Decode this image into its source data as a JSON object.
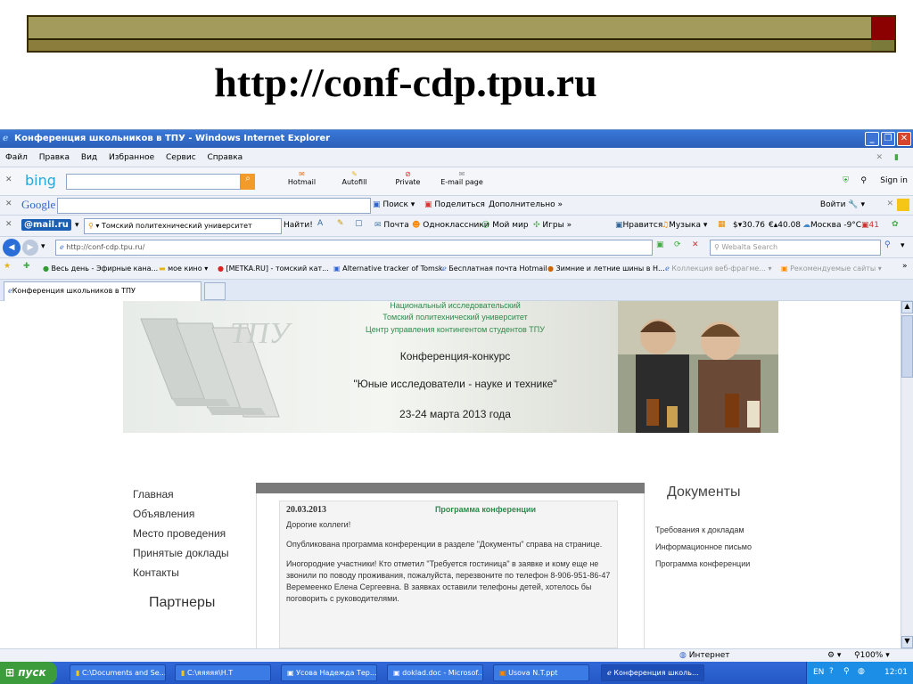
{
  "slide": {
    "title": "http://conf-cdp.tpu.ru"
  },
  "window": {
    "title": "Конференция школьников в ТПУ - Windows Internet Explorer"
  },
  "menu": [
    "Файл",
    "Правка",
    "Вид",
    "Избранное",
    "Сервис",
    "Справка"
  ],
  "bing": {
    "logo": "bing",
    "hotmail": "Hotmail",
    "autofill": "Autofill",
    "private": "Private",
    "email_page": "E-mail page",
    "sign_in": "Sign in"
  },
  "google": {
    "logo": "Google",
    "search": "Поиск",
    "share": "Поделиться",
    "more": "Дополнительно",
    "login": "Войти"
  },
  "mailru": {
    "logo": "@mail.ru",
    "query": "Томский политехнический университет",
    "find": "Найти!",
    "mail": "Почта",
    "ok": "Одноклассники",
    "moimir": "Мой мир",
    "games": "Игры",
    "like": "Нравится",
    "music": "Музыка",
    "usd": "30.76",
    "eur": "40.08",
    "weather": "Москва -9°C",
    "count": "41"
  },
  "address": {
    "url": "http://conf-cdp.tpu.ru/",
    "search_placeholder": "Webalta Search"
  },
  "favorites": [
    "Весь день - Эфирные кана...",
    "мое кино",
    "[METKA.RU] - томский кат...",
    "Alternative tracker of Tomsk",
    "Бесплатная почта Hotmail",
    "Зимние и летние шины в Н...",
    "Коллекция веб-фрагме...",
    "Рекомендуемые сайты"
  ],
  "tab": {
    "label": "Конференция школьников в ТПУ"
  },
  "banner": {
    "line1": "Национальный исследовательский",
    "line2": "Томский политехнический университет",
    "line3": "Центр управления контингентом студентов ТПУ",
    "conf": "Конференция-конкурс",
    "name": "\"Юные исследователи - науке и технике\"",
    "dates": "23-24 марта 2013 года"
  },
  "nav": [
    "Главная",
    "Объявления",
    "Место проведения",
    "Принятые доклады",
    "Контакты"
  ],
  "partners": "Партнеры",
  "post": {
    "date": "20.03.2013",
    "title": "Программа конференции",
    "greeting": "Дорогие коллеги!",
    "p1": "Опубликована программа конференции в разделе \"Документы\" справа на странице.",
    "p2": "Иногородние участники! Кто отметил \"Требуется гостиница\" в заявке и кому еще не звонили по поводу проживания, пожалуйста, перезвоните по телефон 8-906-951-86-47 Веремеенко Елена Сергеевна. В заявках оставили телефоны детей, хотелось бы поговорить с руководителями."
  },
  "documents": {
    "heading": "Документы",
    "items": [
      "Требования к докладам",
      "Информационное письмо",
      "Программа конференции"
    ]
  },
  "status": {
    "zone": "Интернет",
    "zoom": "100%"
  },
  "taskbar": {
    "start": "пуск",
    "items": [
      "C:\\Documents and Se...",
      "C:\\яяяяя\\Н.Т",
      "Усова Надежда Тер...",
      "doklad.doc - Microsof...",
      "Usova N.T.ppt",
      "Конференция школь..."
    ],
    "lang": "EN",
    "clock": "12:01"
  }
}
